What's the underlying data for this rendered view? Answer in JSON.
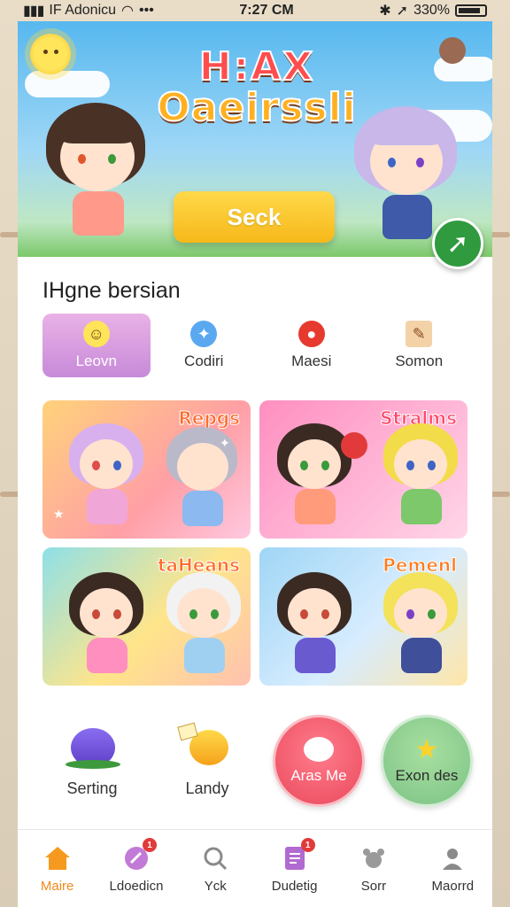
{
  "status_bar": {
    "carrier": "IF Adonicu",
    "time": "7:27 CM",
    "battery": "330%"
  },
  "banner": {
    "logo_line1": "H:AX",
    "logo_line2": "Oaeirssli",
    "search_label": "Seck"
  },
  "section": {
    "title": "IHgne bersian"
  },
  "categories": [
    {
      "label": "Leovn",
      "icon": "smiley-icon"
    },
    {
      "label": "Codiri",
      "icon": "chat-bubble-icon"
    },
    {
      "label": "Maesi",
      "icon": "apple-icon"
    },
    {
      "label": "Somon",
      "icon": "pencil-box-icon"
    }
  ],
  "cards": [
    {
      "title": "Repgs"
    },
    {
      "title": "Stralms"
    },
    {
      "title": "taHeans"
    },
    {
      "title": "Pemenl"
    }
  ],
  "mascots": [
    {
      "label": "Serting"
    },
    {
      "label": "Landy"
    },
    {
      "label": "Aras Me"
    },
    {
      "label": "Exon des"
    }
  ],
  "tabs": [
    {
      "label": "Maire",
      "icon": "home-icon",
      "badge": ""
    },
    {
      "label": "Ldoedicn",
      "icon": "edit-icon",
      "badge": "1"
    },
    {
      "label": "Yck",
      "icon": "search-icon",
      "badge": ""
    },
    {
      "label": "Dudetig",
      "icon": "document-icon",
      "badge": "1"
    },
    {
      "label": "Sorr",
      "icon": "paw-icon",
      "badge": ""
    },
    {
      "label": "Maorrd",
      "icon": "profile-icon",
      "badge": ""
    }
  ],
  "colors": {
    "accent": "#f6b81a",
    "active_tab": "#f08a1a",
    "category_active": "#c78ad9",
    "fab": "#2f9a3e"
  }
}
